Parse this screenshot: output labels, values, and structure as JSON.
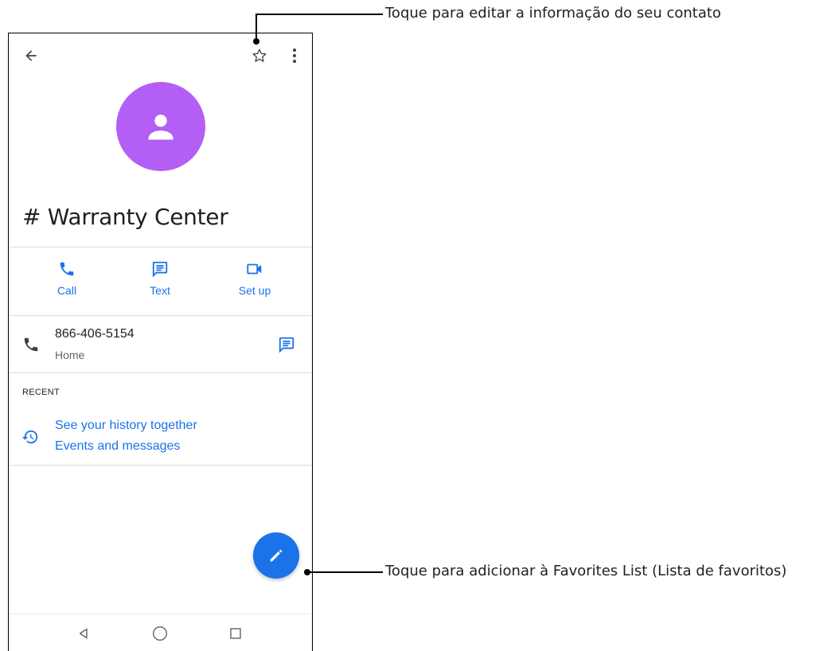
{
  "callouts": {
    "top": "Toque para editar a informação do seu contato",
    "bottom": "Toque para adicionar à Favorites List (Lista de favoritos)"
  },
  "toolbar": {
    "back_icon": "arrow-left-icon",
    "star_icon": "star-outline-icon",
    "menu_icon": "more-vert-icon"
  },
  "contact": {
    "name": "# Warranty Center",
    "avatar_color": "#b35ef5"
  },
  "actions": [
    {
      "label": "Call",
      "icon": "phone-icon"
    },
    {
      "label": "Text",
      "icon": "message-icon"
    },
    {
      "label": "Set up",
      "icon": "video-icon"
    }
  ],
  "phone": {
    "number": "866-406-5154",
    "type": "Home"
  },
  "recent": {
    "section_title": "RECENT",
    "line1": "See your history together",
    "line2": "Events and messages"
  },
  "colors": {
    "accent": "#1a73e8",
    "text": "#202124",
    "secondary": "#5f6368"
  }
}
